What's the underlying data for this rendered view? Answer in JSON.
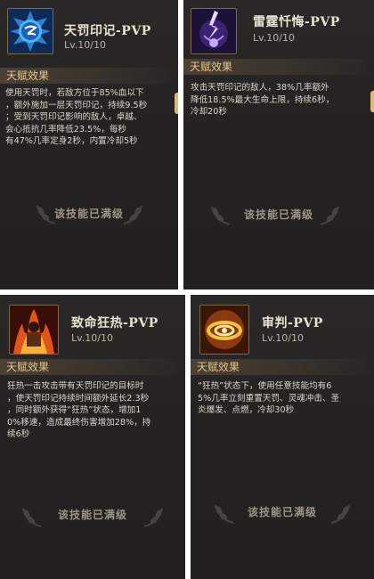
{
  "cards": [
    {
      "icon": "lightning-orb-icon",
      "title": "天罚印记-PVP",
      "level": "Lv.10/10",
      "section": "天赋效果",
      "lines": [
        "使用天罚时，若敌方位于85%血以下",
        "，额外施加一层天罚印记，持续9.5秒",
        "；受到天罚印记影响的敌人，卓越、",
        "会心抵抗几率降低23.5%，每秒",
        "有47%几率定身2秒，内置冷却5秒"
      ],
      "status": "该技能已满级"
    },
    {
      "icon": "purple-lightning-icon",
      "title": "雷霆忏悔-PVP",
      "level": "Lv.10/10",
      "section": "天赋效果",
      "lines": [
        "攻击天罚印记的敌人，38%几率额外",
        "降低18.5%最大生命上限，持续6秒，",
        "冷却20秒"
      ],
      "status": "该技能已满级"
    },
    {
      "icon": "fiery-warrior-icon",
      "title": "致命狂热-PVP",
      "level": "Lv.10/10",
      "section": "天赋效果",
      "lines": [
        "狂热一击攻击带有天罚印记的目标时",
        "，使天罚印记持续时间额外延长2.3秒",
        "，同时额外获得“狂热”状态，增加1",
        "0%移速，造成最终伤害增加28%，持",
        "续6秒"
      ],
      "status": "该技能已满级"
    },
    {
      "icon": "golden-swirl-icon",
      "title": "审判-PVP",
      "level": "Lv.10/10",
      "section": "天赋效果",
      "lines": [
        "“狂热”状态下，使用任意技能均有6",
        "5%几率立刻重置天罚、灵魂冲击、圣",
        "炎爆发、点燃，冷却30秒"
      ],
      "status": "该技能已满级"
    }
  ]
}
